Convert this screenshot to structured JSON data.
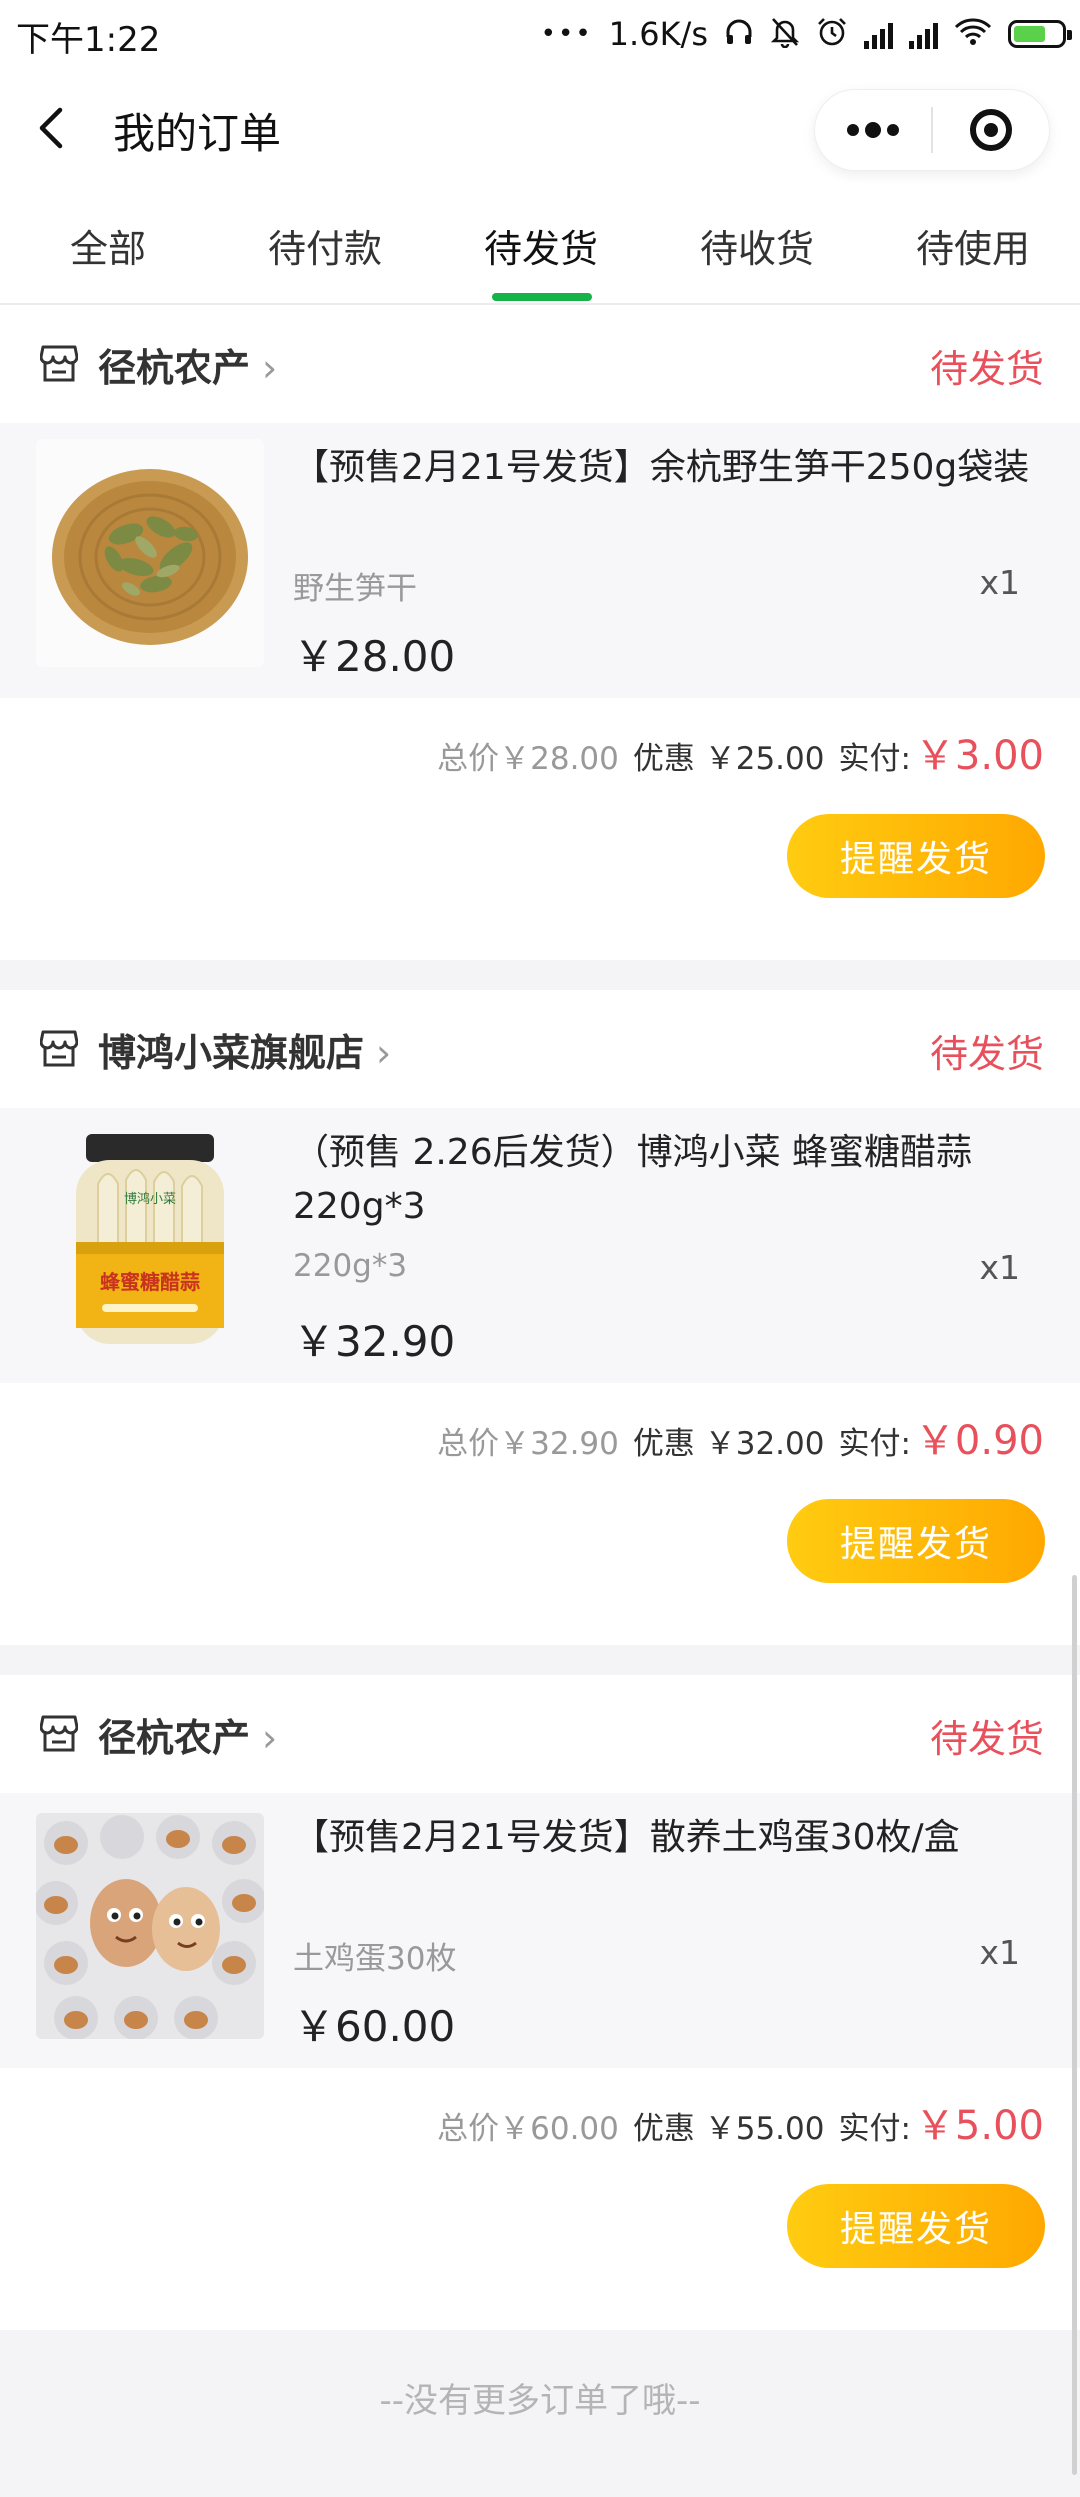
{
  "status_bar": {
    "time": "下午1:22",
    "dots": "•••",
    "net_speed": "1.6K/s"
  },
  "header": {
    "title": "我的订单",
    "more_label": "•••"
  },
  "tabs": [
    {
      "label": "全部"
    },
    {
      "label": "待付款"
    },
    {
      "label": "待发货",
      "active": true
    },
    {
      "label": "待收货"
    },
    {
      "label": "待使用"
    }
  ],
  "orders": [
    {
      "shop_name": "径杭农产",
      "status": "待发货",
      "product_title": "【预售2月21号发货】余杭野生笋干250g袋装",
      "spec": "野生笋干",
      "quantity": "x1",
      "price": "￥28.00",
      "total": "总价￥28.00",
      "discount": "优惠 ￥25.00",
      "paid_label": "实付:",
      "paid_value": "￥3.00",
      "button": "提醒发货"
    },
    {
      "shop_name": "博鸿小菜旗舰店",
      "status": "待发货",
      "product_title": "（预售 2.26后发货）博鸿小菜 蜂蜜糖醋蒜220g*3",
      "spec": "220g*3",
      "quantity": "x1",
      "price": "￥32.90",
      "total": "总价￥32.90",
      "discount": "优惠 ￥32.00",
      "paid_label": "实付:",
      "paid_value": "￥0.90",
      "button": "提醒发货",
      "jar_label": "蜂蜜糖醋蒜",
      "jar_brand": "博鸿小菜"
    },
    {
      "shop_name": "径杭农产",
      "status": "待发货",
      "product_title": "【预售2月21号发货】散养土鸡蛋30枚/盒",
      "spec": "土鸡蛋30枚",
      "quantity": "x1",
      "price": "￥60.00",
      "total": "总价￥60.00",
      "discount": "优惠 ￥55.00",
      "paid_label": "实付:",
      "paid_value": "￥5.00",
      "button": "提醒发货"
    }
  ],
  "footer_text": "--没有更多订单了哦--",
  "colors": {
    "accent_green": "#16b24a",
    "status_red": "#e8505b",
    "button_yellow": "#ffc107"
  }
}
